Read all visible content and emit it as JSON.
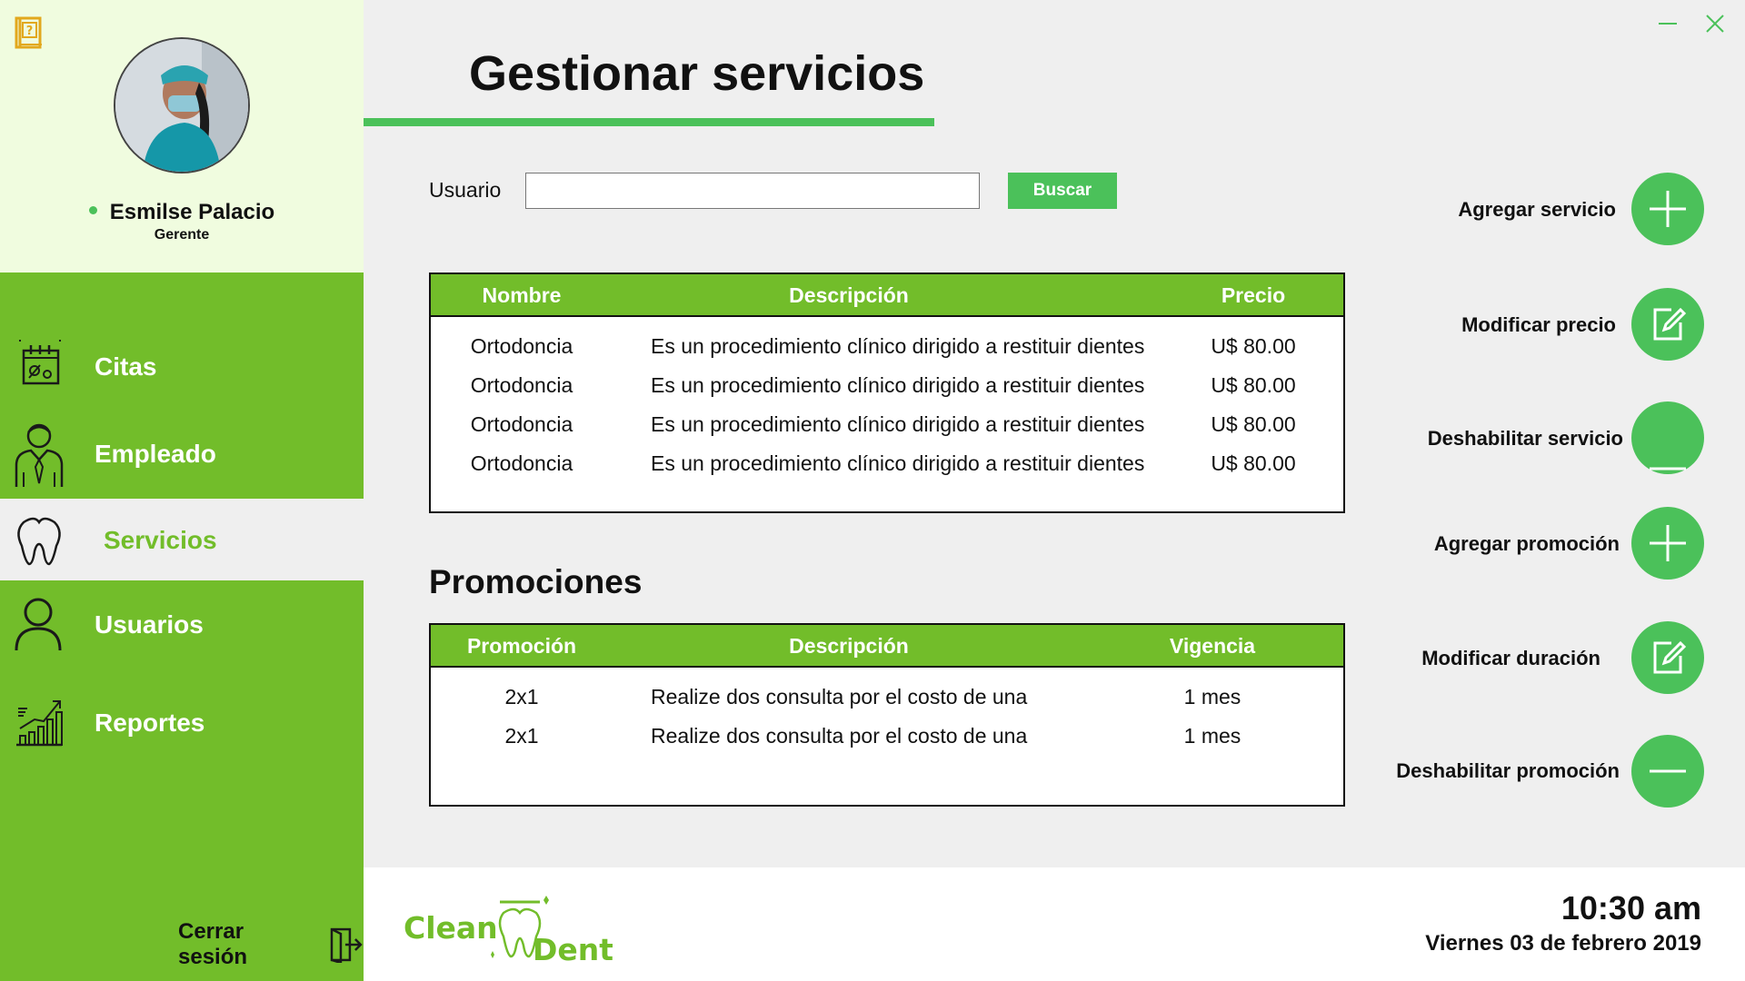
{
  "window": {
    "title": "Gestionar servicios",
    "controls": [
      "minimize-icon",
      "close-icon"
    ],
    "accent_color": "#4bc15a",
    "sidebar_color": "#72bd2a"
  },
  "profile": {
    "name": "Esmilse Palacio",
    "role": "Gerente",
    "status_color": "#4bc15a"
  },
  "nav": {
    "items": [
      {
        "label": "Citas",
        "icon": "calendar-icon"
      },
      {
        "label": "Empleado",
        "icon": "employee-icon"
      },
      {
        "label": "Servicios",
        "icon": "tooth-icon",
        "active": true
      },
      {
        "label": "Usuarios",
        "icon": "user-icon"
      },
      {
        "label": "Reportes",
        "icon": "chart-icon"
      }
    ],
    "logout_label": "Cerrar sesión"
  },
  "search": {
    "label": "Usuario",
    "value": "",
    "placeholder": "",
    "button_label": "Buscar"
  },
  "services_table": {
    "headers": [
      "Nombre",
      "Descripción",
      "Precio"
    ],
    "rows": [
      [
        "Ortodoncia",
        "Es un procedimiento clínico dirigido a restituir dientes",
        "U$ 80.00"
      ],
      [
        "Ortodoncia",
        "Es un procedimiento clínico dirigido a restituir dientes",
        "U$ 80.00"
      ],
      [
        "Ortodoncia",
        "Es un procedimiento clínico dirigido a restituir dientes",
        "U$ 80.00"
      ],
      [
        "Ortodoncia",
        "Es un procedimiento clínico dirigido a restituir dientes",
        "U$ 80.00"
      ]
    ]
  },
  "promotions": {
    "title": "Promociones",
    "headers": [
      "Promoción",
      "Descripción",
      "Vigencia"
    ],
    "rows": [
      [
        "2x1",
        "Realize dos consulta por el costo de una",
        "1 mes"
      ],
      [
        "2x1",
        "Realize dos consulta por el costo de una",
        "1 mes"
      ]
    ]
  },
  "actions": [
    {
      "label": "Agregar servicio",
      "icon": "plus-icon"
    },
    {
      "label": "Modificar precio",
      "icon": "edit-icon"
    },
    {
      "label": "Deshabilitar servicio",
      "icon": "minus-icon"
    },
    {
      "label": "Agregar promoción",
      "icon": "plus-icon"
    },
    {
      "label": "Modificar duración",
      "icon": "edit-icon"
    },
    {
      "label": "Deshabilitar promoción",
      "icon": "minus-icon"
    }
  ],
  "footer": {
    "brand_part1": "Clean",
    "brand_part2": "Dent",
    "time": "10:30 am",
    "date": "Viernes 03 de febrero 2019"
  }
}
